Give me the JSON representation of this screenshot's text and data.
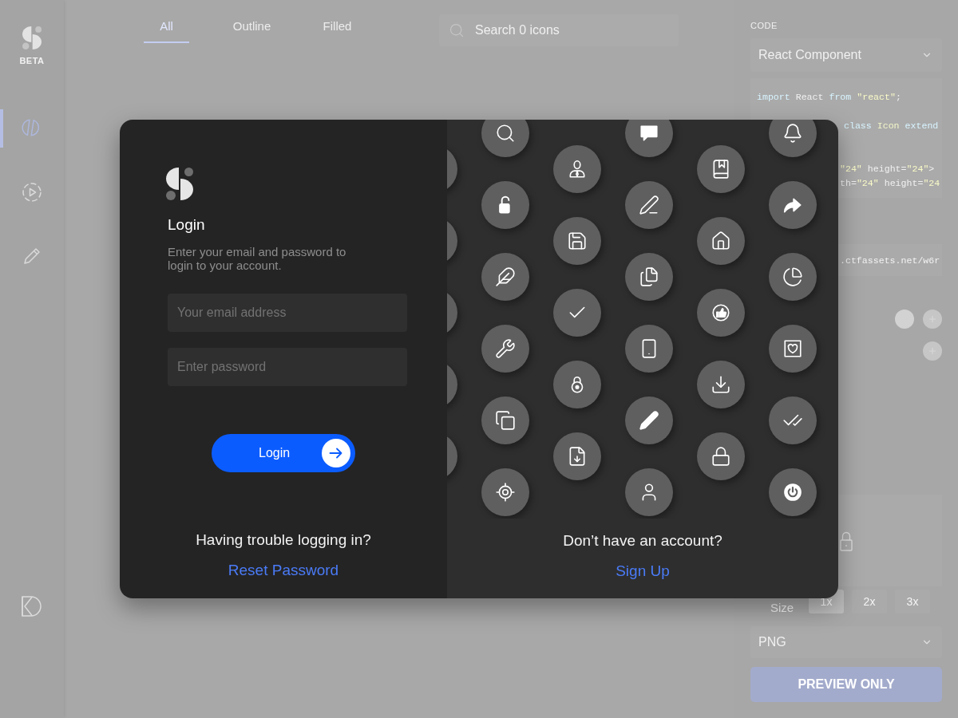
{
  "sidebar": {
    "badge": "BETA",
    "items": [
      {
        "selected": true
      },
      {
        "selected": false
      },
      {
        "selected": false
      }
    ]
  },
  "tabs": [
    {
      "label": "All",
      "selected": true
    },
    {
      "label": "Outline",
      "selected": false
    },
    {
      "label": "Filled",
      "selected": false
    }
  ],
  "search": {
    "placeholder": "Search 0 icons"
  },
  "code_panel": {
    "heading": "CODE",
    "format": "React Component",
    "code_lines": [
      {
        "tokens": [
          {
            "kind": "keyword",
            "text": "import"
          },
          {
            "kind": "plain",
            "text": " React "
          },
          {
            "kind": "keyword",
            "text": "from "
          },
          {
            "kind": "string",
            "text": "\"react\""
          },
          {
            "kind": "plain",
            "text": ";"
          }
        ]
      },
      {
        "tokens": [
          {
            "kind": "keyword",
            "text": "class "
          },
          {
            "kind": "type",
            "text": "Icon "
          },
          {
            "kind": "keyword",
            "text": "extend"
          }
        ]
      },
      {
        "tokens": [
          {
            "kind": "string",
            "text": "\"24\""
          },
          {
            "kind": "plain",
            "text": " height="
          },
          {
            "kind": "string",
            "text": "\"24\""
          },
          {
            "kind": "plain",
            "text": ">"
          }
        ]
      },
      {
        "tokens": [
          {
            "kind": "plain",
            "text": "th="
          },
          {
            "kind": "string",
            "text": "\"24\""
          },
          {
            "kind": "plain",
            "text": " height="
          },
          {
            "kind": "string",
            "text": "\"24"
          }
        ]
      }
    ],
    "url": ".ctfassets.net/w6r"
  },
  "export": {
    "size_label": "Size",
    "sizes": [
      {
        "label": "1x",
        "selected": true
      },
      {
        "label": "2x",
        "selected": false
      },
      {
        "label": "3x",
        "selected": false
      }
    ],
    "format": "PNG",
    "button": "PREVIEW ONLY"
  },
  "login_modal": {
    "login": {
      "title": "Login",
      "description": "Enter your email and password to login to your account.",
      "email_placeholder": "Your email address",
      "password_placeholder": "Enter password",
      "button": "Login",
      "help_text": "Having trouble logging in?",
      "help_link": "Reset Password"
    },
    "signup": {
      "prompt": "Don’t have an account?",
      "link": "Sign Up"
    }
  }
}
